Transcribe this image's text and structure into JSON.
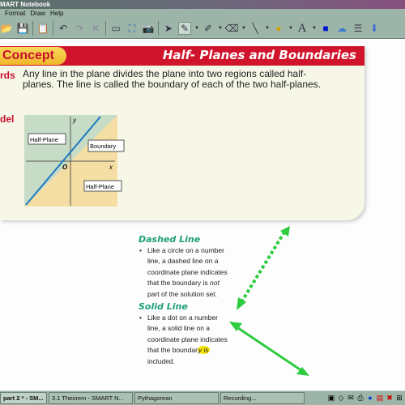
{
  "window": {
    "title": "MART Notebook"
  },
  "menu": [
    "Format",
    "Draw",
    "Help"
  ],
  "toolbar": {
    "icons": [
      "open-icon",
      "save-icon",
      "paste-icon",
      "undo-icon",
      "redo-icon",
      "delete-icon",
      "screen-shade-icon",
      "full-screen-icon",
      "capture-icon",
      "select-icon",
      "pen-icon",
      "creative-pen-icon",
      "eraser-icon",
      "line-icon",
      "shape-icon",
      "text-icon",
      "fill-color-icon",
      "gallery-icon",
      "properties-icon",
      "attach-icon"
    ]
  },
  "card": {
    "concept_label": "Concept",
    "title": "Half- Planes and Boundaries",
    "words_label": "rds",
    "words_text": "Any line in the plane divides the plane into two regions called half-planes. The line is called the boundary of each of the two half-planes.",
    "model_label": "del",
    "graph": {
      "label_half_plane_top": "Half-Plane",
      "label_boundary": "Boundary",
      "label_half_plane_bottom": "Half-Plane",
      "axis_x": "x",
      "axis_y": "y",
      "origin": "O"
    }
  },
  "notes": {
    "dashed_heading": "Dashed Line",
    "dashed_text_a": "Like a circle on a number line, a dashed line on a coordinate plane indicates that the boundary is ",
    "dashed_em": "not",
    "dashed_text_b": " part of the solution set.",
    "solid_heading": "Solid Line",
    "solid_text_a": "Like a dot on a number line, a solid line on a coordinate plane indicates that the boundar",
    "solid_highlight": "y is",
    "solid_text_b": " included."
  },
  "annotation_color": "#2ecc40",
  "taskbar": {
    "tasks": [
      "part 2 * - SM...",
      "3.1 Theorem - SMART N...",
      "Pythagorean",
      "Recording..."
    ]
  }
}
